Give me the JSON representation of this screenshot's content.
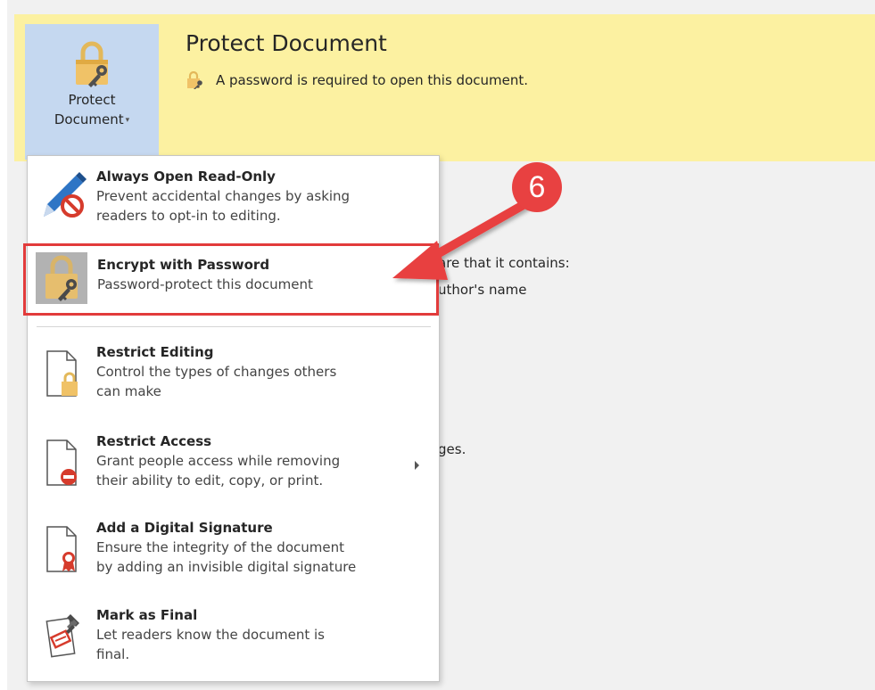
{
  "info_band": {
    "button_label_line1": "Protect",
    "button_label_line2": "Document",
    "title": "Protect Document",
    "description": "A password is required to open this document."
  },
  "background_text": {
    "line1": "are that it contains:",
    "line2": "uthor's name",
    "line3": "ges."
  },
  "menu": {
    "items": [
      {
        "title": "Always Open Read-Only",
        "desc1": "Prevent accidental changes by asking",
        "desc2": "readers to opt-in to editing.",
        "icon": "read-only-pencil-icon"
      },
      {
        "title": "Encrypt with Password",
        "desc1": "Password-protect this document",
        "icon": "lock-key-icon"
      },
      {
        "title": "Restrict Editing",
        "desc1": "Control the types of changes others",
        "desc2": "can make",
        "icon": "document-lock-icon"
      },
      {
        "title": "Restrict Access",
        "desc1": "Grant people access while removing",
        "desc2": "their ability to edit, copy, or print.",
        "icon": "document-restricted-icon"
      },
      {
        "title": "Add a Digital Signature",
        "desc1": "Ensure the integrity of the document",
        "desc2": "by adding an invisible digital signature",
        "icon": "document-ribbon-icon"
      },
      {
        "title": "Mark as Final",
        "desc1": "Let readers know the document is",
        "desc2": "final.",
        "icon": "stamp-icon"
      }
    ]
  },
  "annotation": {
    "step_number": "6",
    "color": "#e84141"
  }
}
